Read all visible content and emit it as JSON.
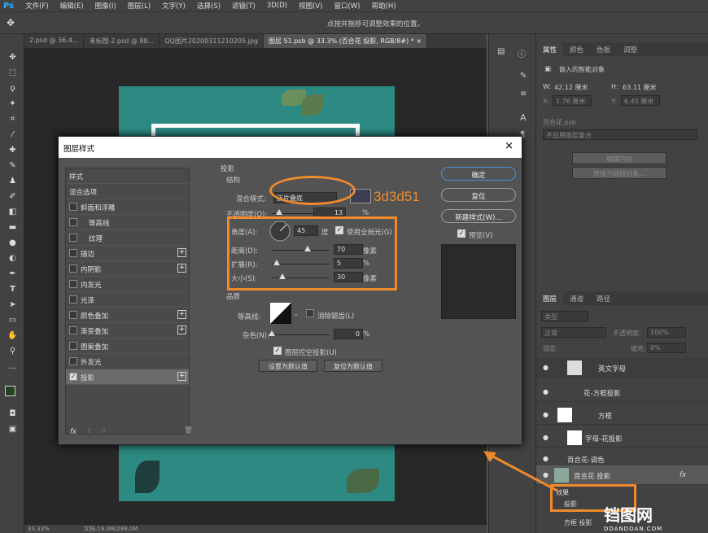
{
  "menu": {
    "logo": "Ps",
    "items": [
      "文件(F)",
      "编辑(E)",
      "图像(I)",
      "图层(L)",
      "文字(Y)",
      "选择(S)",
      "滤镜(T)",
      "3D(D)",
      "视图(V)",
      "窗口(W)",
      "帮助(H)"
    ]
  },
  "options": {
    "hint": "点按并拖移可调整效果的位置。"
  },
  "tabs": [
    {
      "label": "2.psd @ 36.4..."
    },
    {
      "label": "未标题-2.psd @ 88..."
    },
    {
      "label": "QQ图片20200311210205.jpg"
    },
    {
      "label": "图层 51.psb @ 33.3% (百合花 投影, RGB/8#) * ×"
    }
  ],
  "properties": {
    "tabs": [
      "属性",
      "颜色",
      "色板",
      "调整"
    ],
    "smart_object": "嵌入的智能对象",
    "w_label": "W:",
    "w_value": "42.12 厘米",
    "h_label": "H:",
    "h_value": "63.11 厘米",
    "x_label": "X:",
    "x_value": "1.76 厘米",
    "y_label": "Y:",
    "y_value": "6.45 厘米",
    "file": "百合花.psb",
    "comp": "不应用图层复合",
    "edit_btn": "编辑内容",
    "convert_btn": "转换为链接对象..."
  },
  "layers": {
    "tabs": [
      "图层",
      "通道",
      "路径"
    ],
    "filter": "类型",
    "blend": "正常",
    "opacity_label": "不透明度:",
    "opacity": "100%",
    "lock_label": "锁定:",
    "fill_label": "填充:",
    "fill": "0%",
    "rows": [
      "英文字母",
      "花-方框投影",
      "方框",
      "字母-花投影",
      "百合花-调色",
      "百合花 投影"
    ],
    "fx_label": "fx",
    "effects_label": "效果",
    "shadow_label": "投影",
    "bottom_row": "方框 投影"
  },
  "dialog": {
    "title": "图层样式",
    "close": "×",
    "styles": [
      {
        "label": "样式",
        "check": false,
        "plus": false
      },
      {
        "label": "混合选项",
        "check": false,
        "plus": false
      },
      {
        "label": "斜面和浮雕",
        "check": true,
        "plus": false
      },
      {
        "label": "等高线",
        "check": true,
        "plus": false
      },
      {
        "label": "纹理",
        "check": true,
        "plus": false
      },
      {
        "label": "描边",
        "check": true,
        "plus": true
      },
      {
        "label": "内阴影",
        "check": true,
        "plus": true
      },
      {
        "label": "内发光",
        "check": true,
        "plus": false
      },
      {
        "label": "光泽",
        "check": true,
        "plus": false
      },
      {
        "label": "颜色叠加",
        "check": true,
        "plus": true
      },
      {
        "label": "渐变叠加",
        "check": true,
        "plus": true
      },
      {
        "label": "图案叠加",
        "check": true,
        "plus": false
      },
      {
        "label": "外发光",
        "check": true,
        "plus": false
      },
      {
        "label": "投影",
        "check": true,
        "plus": true,
        "checked": true,
        "selected": true
      }
    ],
    "fx": "fx",
    "section": "投影",
    "structure": "结构",
    "blend_label": "混合模式:",
    "blend_value": "正片叠底",
    "shadow_color": "#3d3d51",
    "color_note": "3d3d51",
    "opacity_label": "不透明度(O):",
    "opacity_value": "13",
    "opacity_unit": "%",
    "angle_label": "角度(A):",
    "angle_value": "45",
    "angle_unit": "度",
    "global_light": "使用全局光(G)",
    "distance_label": "距离(D):",
    "distance_value": "70",
    "distance_unit": "像素",
    "spread_label": "扩展(R):",
    "spread_value": "5",
    "spread_unit": "%",
    "size_label": "大小(S):",
    "size_value": "30",
    "size_unit": "像素",
    "quality": "品质",
    "contour_label": "等高线:",
    "antialias": "消除锯齿(L)",
    "noise_label": "杂色(N):",
    "noise_value": "0",
    "noise_unit": "%",
    "knockout": "图层挖空投影(U)",
    "set_default": "设置为默认值",
    "reset_default": "复位为默认值",
    "ok": "确定",
    "reset": "复位",
    "new_style": "新建样式(W)...",
    "preview": "预览(V)"
  },
  "status": {
    "zoom": "33.33%",
    "doc": "文档:19.0M/299.0M"
  },
  "watermark": {
    "main": "铛图网",
    "sub": "DDANDOAN.COM"
  }
}
